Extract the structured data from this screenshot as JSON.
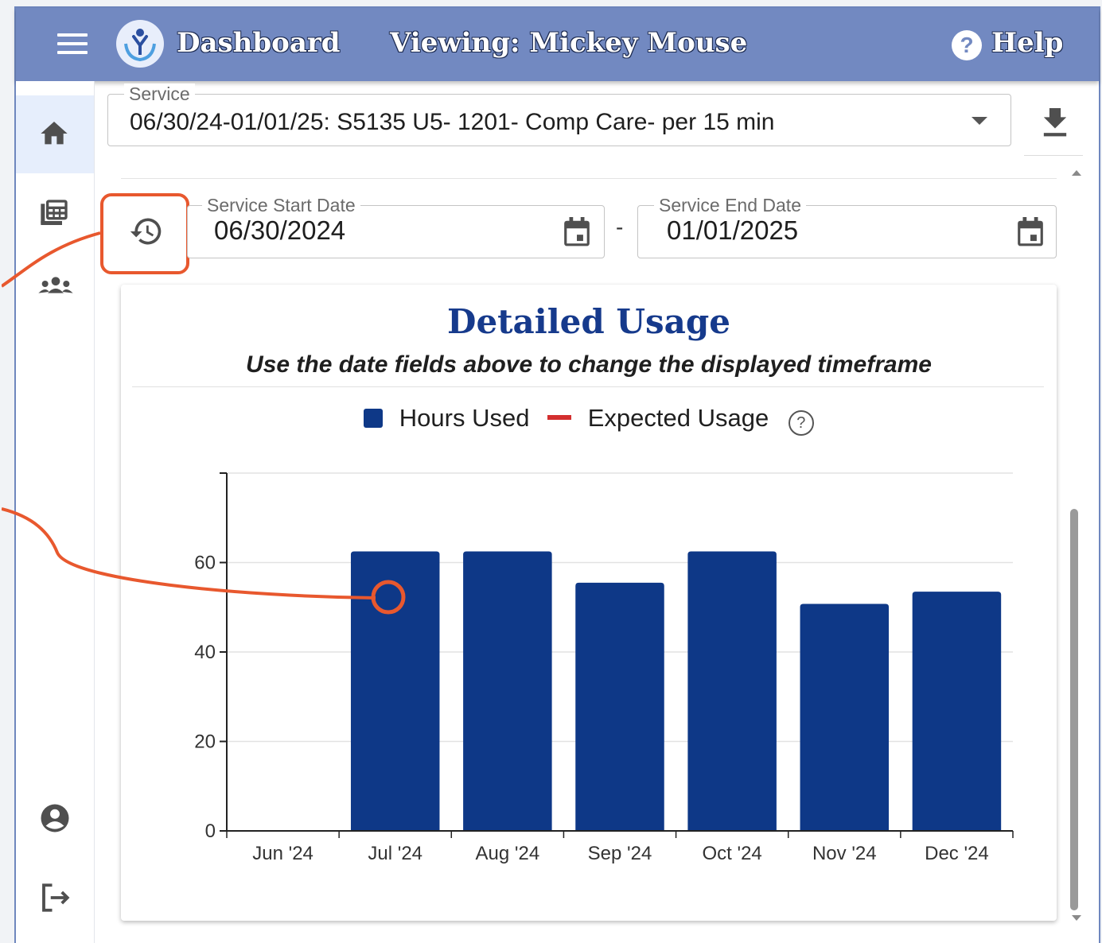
{
  "appbar": {
    "title": "Dashboard",
    "viewing": "Viewing: Mickey Mouse",
    "help_icon": "?",
    "help_label": "Help"
  },
  "service": {
    "label": "Service",
    "value": "06/30/24-01/01/25: S5135 U5- 1201- Comp Care- per 15 min"
  },
  "dates": {
    "start_label": "Service Start Date",
    "start_value": "06/30/2024",
    "separator": "-",
    "end_label": "Service End Date",
    "end_value": "01/01/2025"
  },
  "card": {
    "title": "Detailed Usage",
    "subtitle": "Use the date fields above to change the displayed timeframe"
  },
  "legend": {
    "hours_used": "Hours Used",
    "expected_usage": "Expected Usage",
    "help_icon": "?"
  },
  "sidebar": {
    "items": [
      "home-icon",
      "calculator-icon",
      "people-group-icon",
      "account-icon",
      "logout-icon"
    ],
    "active": "home-icon"
  },
  "colors": {
    "appbar": "#7289c1",
    "bar": "#0e3887",
    "expected": "#d32f2f",
    "highlight": "#e8582e",
    "title": "#163a8c"
  },
  "chart_data": {
    "type": "bar",
    "categories": [
      "Jun '24",
      "Jul '24",
      "Aug '24",
      "Sep '24",
      "Oct '24",
      "Nov '24",
      "Dec '24"
    ],
    "series": [
      {
        "name": "Hours Used",
        "values": [
          0,
          62.5,
          62.5,
          55.5,
          62.5,
          50.75,
          53.5
        ]
      }
    ],
    "yticks": [
      0,
      20,
      40,
      60
    ],
    "ylim": [
      0,
      80
    ],
    "grid": true,
    "legend": "top-center"
  }
}
